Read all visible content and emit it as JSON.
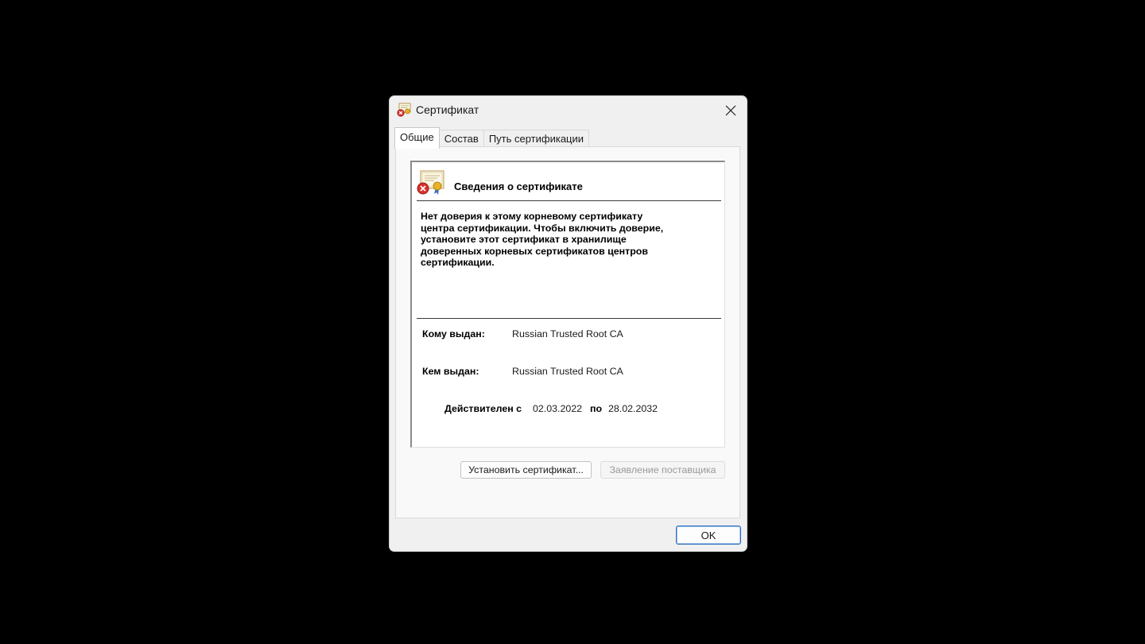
{
  "window": {
    "title": "Сертификат",
    "close_icon": "close-icon",
    "title_icon": "certificate-error-icon"
  },
  "tabs": [
    {
      "label": "Общие",
      "active": true
    },
    {
      "label": "Состав",
      "active": false
    },
    {
      "label": "Путь сертификации",
      "active": false
    }
  ],
  "info": {
    "heading": "Сведения о сертификате",
    "warning_lines": [
      "Нет доверия к этому корневому сертификату",
      "центра сертификации. Чтобы включить  доверие,",
      "установите этот сертификат в хранилище",
      "доверенных корневых сертификатов центров",
      "сертификации."
    ],
    "issued_to_label": "Кому выдан:",
    "issued_to_value": "Russian Trusted Root CA",
    "issued_by_label": "Кем выдан:",
    "issued_by_value": "Russian Trusted Root CA",
    "valid_from_label": "Действителен с",
    "valid_from_value": "02.03.2022",
    "valid_to_label": "по",
    "valid_to_value": "28.02.2032"
  },
  "buttons": {
    "install": "Установить сертификат...",
    "issuer_statement": "Заявление поставщика",
    "ok": "OK"
  },
  "colors": {
    "background": "#000000",
    "dialog": "#f0f0f0",
    "ok_border": "#2f6fbd",
    "disabled_text": "#9a9a9a"
  }
}
